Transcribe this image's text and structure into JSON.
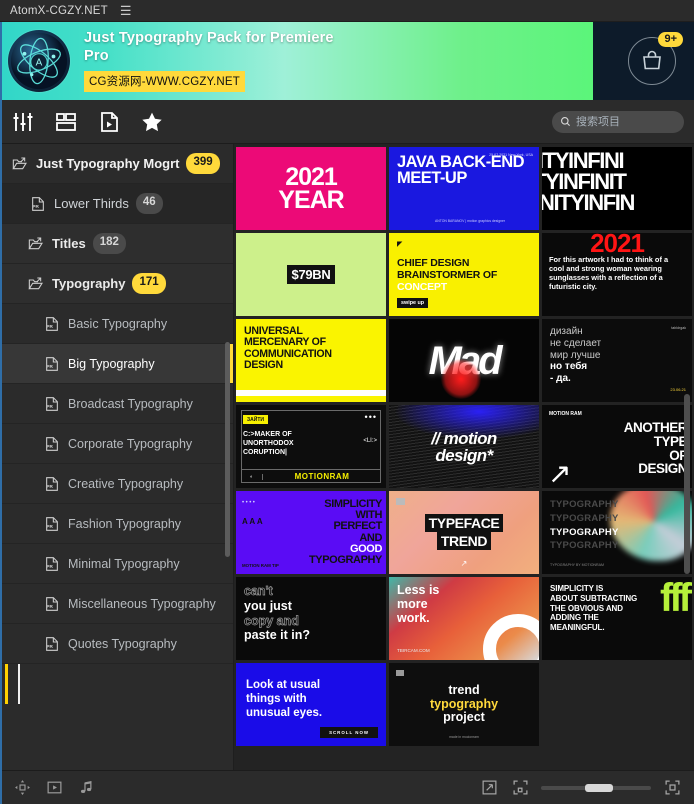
{
  "window": {
    "app_title": "AtomX-CGZY.NET",
    "menu_icon": "hamburger-icon"
  },
  "banner": {
    "title": "Just Typography Pack for Premiere Pro",
    "watermark": "CG资源网-WWW.CGZY.NET",
    "cart_badge": "9+",
    "logo_letter": "A",
    "gradient_start": "#31d6c8",
    "gradient_end": "#5bf57a",
    "badge_color": "#ffd93b"
  },
  "toolbar": {
    "tools": [
      {
        "name": "sliders-icon",
        "label": "Adjustments"
      },
      {
        "name": "layout-list-icon",
        "label": "Layouts"
      },
      {
        "name": "file-video-icon",
        "label": "Media"
      },
      {
        "name": "star-icon",
        "label": "Favorites"
      }
    ],
    "search": {
      "placeholder": "搜索项目",
      "value": "",
      "icon": "search-icon"
    }
  },
  "sidebar": {
    "tree": [
      {
        "label": "Just Typography Mogrt",
        "count": "399",
        "level": 0,
        "icon": "folder-arrow-icon",
        "chip": "yellow",
        "selected": false
      },
      {
        "label": "Lower Thirds",
        "count": "46",
        "level": 1,
        "icon": "pr-file-icon",
        "chip": "grey",
        "selected": false
      },
      {
        "label": "Titles",
        "count": "182",
        "level": 2,
        "icon": "folder-arrow-icon",
        "chip": "grey",
        "selected": false
      },
      {
        "label": "Typography",
        "count": "171",
        "level": 2,
        "icon": "folder-arrow-icon",
        "chip": "yellow",
        "selected": false
      },
      {
        "label": "Basic Typography",
        "count": "",
        "level": 3,
        "icon": "pr-file-icon",
        "chip": "",
        "selected": false
      },
      {
        "label": "Big Typography",
        "count": "",
        "level": 3,
        "icon": "pr-file-icon",
        "chip": "",
        "selected": true
      },
      {
        "label": "Broadcast Typography",
        "count": "",
        "level": 3,
        "icon": "pr-file-icon",
        "chip": "",
        "selected": false
      },
      {
        "label": "Corporate Typography",
        "count": "",
        "level": 3,
        "icon": "pr-file-icon",
        "chip": "",
        "selected": false
      },
      {
        "label": "Creative Typography",
        "count": "",
        "level": 3,
        "icon": "pr-file-icon",
        "chip": "",
        "selected": false
      },
      {
        "label": "Fashion Typography",
        "count": "",
        "level": 3,
        "icon": "pr-file-icon",
        "chip": "",
        "selected": false
      },
      {
        "label": "Minimal Typography",
        "count": "",
        "level": 3,
        "icon": "pr-file-icon",
        "chip": "",
        "selected": false
      },
      {
        "label": "Miscellaneous Typography",
        "count": "",
        "level": 3,
        "icon": "pr-file-icon",
        "chip": "",
        "selected": false
      },
      {
        "label": "Quotes Typography",
        "count": "",
        "level": 3,
        "icon": "pr-file-icon",
        "chip": "",
        "selected": false
      }
    ]
  },
  "grid": {
    "items": [
      {
        "id": "t-2021year",
        "line1": "2021",
        "line2": "YEAR"
      },
      {
        "id": "t-java",
        "line1": "JAVA BACK-END MEET-UP",
        "corner": "25.07.2021\nNew-York, USA",
        "foot": "ANTON BARANOV  |  motion\ngraphics designer"
      },
      {
        "id": "t-infinity",
        "line1": "ITYINFINI",
        "line2": "TYINFINIT",
        "line3": "NITYINFIN"
      },
      {
        "id": "t-79bn",
        "line1": "$79BN"
      },
      {
        "id": "t-chief",
        "mark": "◤",
        "line1": "CHIEF DESIGN",
        "line2": "BRAINSTORMER OF",
        "line3": "CONCEPT",
        "button": "swipe up"
      },
      {
        "id": "t-red2021",
        "line1": "2021",
        "paragraph": "For this artwork I had to think of a cool and strong woman wearing sunglasses with a reflection of a futuristic city."
      },
      {
        "id": "t-universal",
        "line1": "UNIVERSAL",
        "line2": "MERCENARY OF",
        "line3": "COMMUNICATION",
        "line4": "DESIGN"
      },
      {
        "id": "t-mad",
        "line1": "Mad"
      },
      {
        "id": "t-dizayn",
        "line1": "дизайн",
        "line2": "не сделает",
        "line3": "мир лучше",
        "line4": "но тебя",
        "line5": "- да.",
        "corner": "tabldrgak",
        "date": "23.06.21"
      },
      {
        "id": "t-maker",
        "tag": "ЗАЙТИ",
        "dots": "•••",
        "line1": "C:>MAKER OF",
        "line2": "UNORTHODOX",
        "line3": "CORUPTION|",
        "li": "<LI:>",
        "footer": "MOTIONRAM"
      },
      {
        "id": "t-motion",
        "line1": "// motion",
        "line2": "design*"
      },
      {
        "id": "t-another",
        "brand": "MOTION RAM",
        "line1": "ANOTHER",
        "line2": "TYPE",
        "line3": "OF",
        "line4": "DESIGN",
        "arrow": "↗"
      },
      {
        "id": "t-simplicity",
        "dots": "••••",
        "aaa": "A A A",
        "line1": "SIMPLICITY",
        "line2": "WITH",
        "line3": "PERFECT",
        "line4": "AND",
        "line5": "GOOD",
        "line6": "TYPOGRAPHY",
        "brand": "MOTION RAM TIP"
      },
      {
        "id": "t-typeface",
        "line1": "TYPEFACE",
        "line2": "TREND",
        "foot": "↗"
      },
      {
        "id": "t-typo4",
        "line1": "TYPOGRAPHY",
        "line2": "TYPOGRAPHY",
        "line3": "TYPOGRAPHY",
        "line4": "TYPOGRAPHY",
        "credit": "TYPOGRAPHY BY MOTIONRAM"
      },
      {
        "id": "t-cant",
        "line1": "can't",
        "line2": "you just",
        "line3": "copy and",
        "line4": "paste it in?"
      },
      {
        "id": "t-less",
        "line1": "Less is",
        "line2": "more",
        "line3": "work.",
        "url": "TBIRCAM.COM"
      },
      {
        "id": "t-green",
        "line1": "SIMPLICITY IS",
        "line2": "ABOUT SUBTRACTING",
        "line3": "THE OBVIOUS AND",
        "line4": "ADDING THE",
        "line5": "MEANINGFUL.",
        "blob": "fff"
      },
      {
        "id": "t-look",
        "line1": "Look at usual",
        "line2": "things with",
        "line3": "unusual eyes.",
        "button": "SCROLL NOW"
      },
      {
        "id": "t-trend",
        "line1": "trend",
        "line2": "typography",
        "line3": "project",
        "credit": "made in mocionram"
      }
    ]
  },
  "bottombar": {
    "left_tools": [
      {
        "name": "transform-icon"
      },
      {
        "name": "play-box-icon"
      },
      {
        "name": "music-note-icon"
      }
    ],
    "right_tools": [
      {
        "name": "expand-arrows-icon"
      },
      {
        "name": "fit-frame-icon"
      },
      {
        "name": "fullscreen-icon"
      }
    ],
    "zoom_slider_value": "40"
  }
}
